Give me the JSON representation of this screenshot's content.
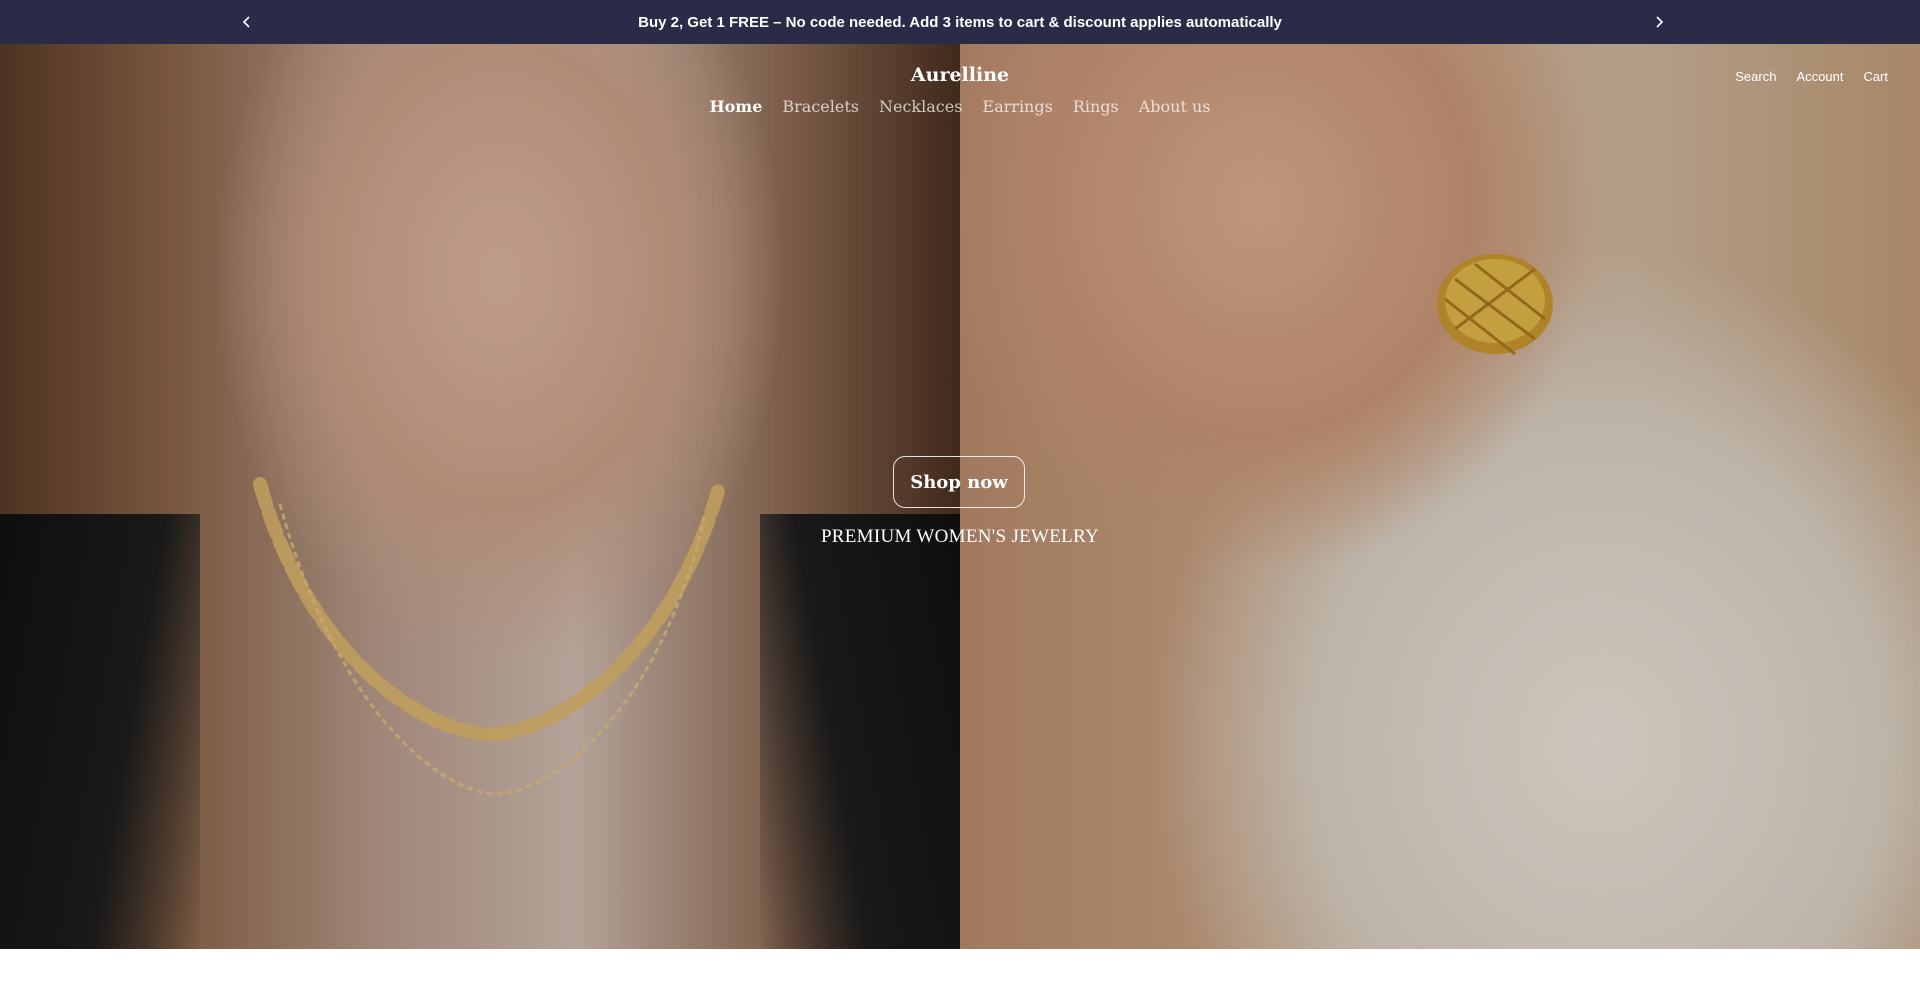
{
  "announcement": {
    "text": "Buy 2, Get 1 FREE – No code needed. Add 3 items to cart & discount applies automatically",
    "prev_icon": "chevron-left-icon",
    "next_icon": "chevron-right-icon",
    "background": "#2a2b47"
  },
  "header": {
    "logo": "Aurelline",
    "nav": [
      {
        "label": "Home",
        "active": true
      },
      {
        "label": "Bracelets",
        "active": false
      },
      {
        "label": "Necklaces",
        "active": false
      },
      {
        "label": "Earrings",
        "active": false
      },
      {
        "label": "Rings",
        "active": false
      },
      {
        "label": "About us",
        "active": false
      }
    ],
    "actions": {
      "search": "Search",
      "account": "Account",
      "cart": "Cart"
    }
  },
  "hero": {
    "button_label": "Shop now",
    "tagline": "PREMIUM WOMEN'S JEWELRY"
  }
}
